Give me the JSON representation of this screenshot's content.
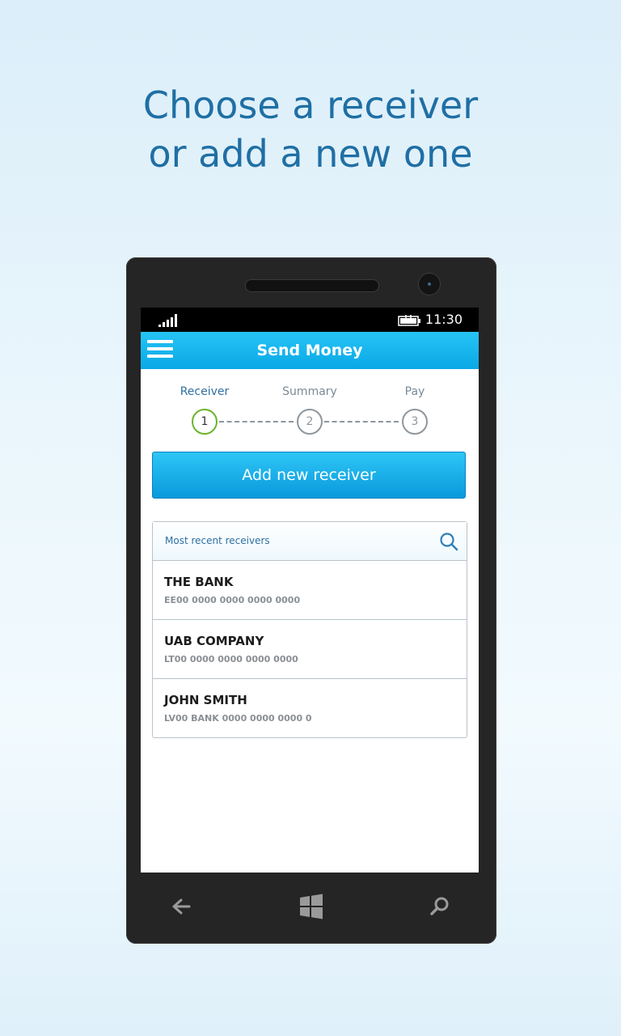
{
  "headline": {
    "line1": "Choose a receiver",
    "line2": "or add a new one"
  },
  "status_bar": {
    "time": "11:30",
    "icons": [
      "signal-icon",
      "battery-charging-icon"
    ]
  },
  "app_bar": {
    "title": "Send Money",
    "menu_icon": "hamburger-menu-icon"
  },
  "steps": [
    {
      "label": "Receiver",
      "number": "1",
      "active": true
    },
    {
      "label": "Summary",
      "number": "2",
      "active": false
    },
    {
      "label": "Pay",
      "number": "3",
      "active": false
    }
  ],
  "add_button": {
    "label": "Add new receiver"
  },
  "receivers_list": {
    "header": "Most recent receivers",
    "search_icon": "search-icon",
    "items": [
      {
        "name": "THE BANK",
        "account": "EE00 0000 0000 0000 0000"
      },
      {
        "name": "UAB COMPANY",
        "account": "LT00 0000 0000 0000 0000"
      },
      {
        "name": "JOHN SMITH",
        "account": "LV00 BANK 0000 0000 0000 0"
      }
    ]
  },
  "nav_bar": {
    "icons": [
      "back-arrow-icon",
      "windows-logo-icon",
      "search-icon"
    ]
  },
  "colors": {
    "accent": "#0aa8e6",
    "headline": "#1f6fa5",
    "active_step": "#6ab42c"
  }
}
